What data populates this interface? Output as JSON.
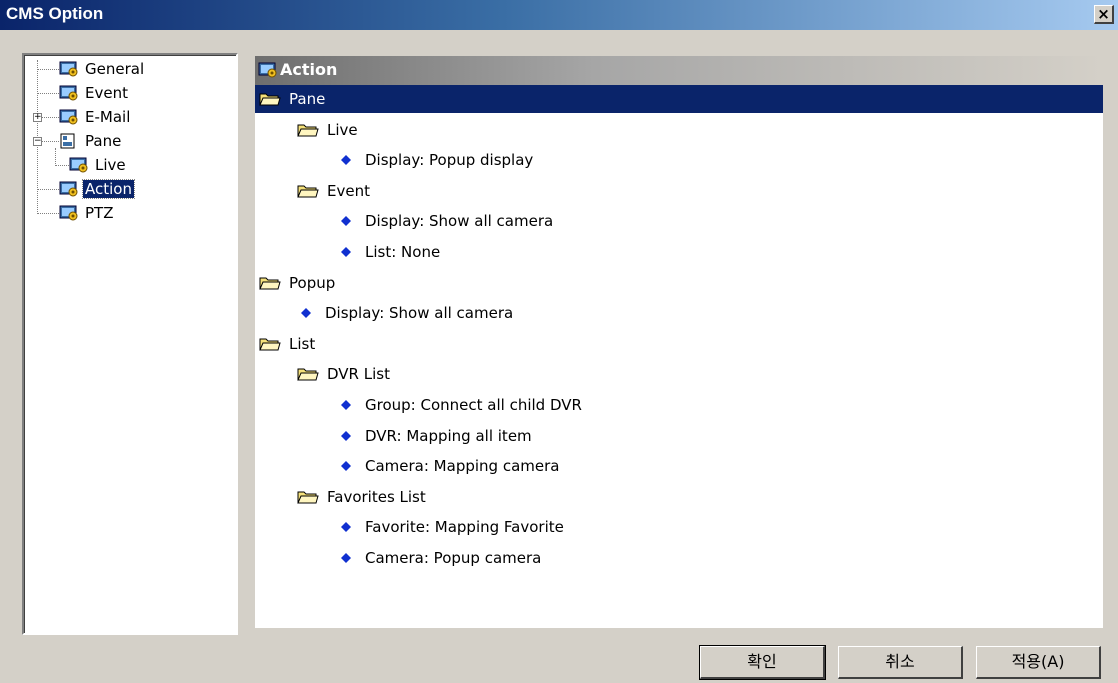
{
  "window": {
    "title": "CMS Option",
    "close_label": "×"
  },
  "tree": [
    {
      "label": "General"
    },
    {
      "label": "Event"
    },
    {
      "label": "E-Mail",
      "expander": "+"
    },
    {
      "label": "Pane",
      "expander": "−"
    },
    {
      "label": "Live"
    },
    {
      "label": "Action",
      "selected": true
    },
    {
      "label": "PTZ"
    }
  ],
  "content": {
    "header": "Action",
    "items": [
      {
        "label": "Pane",
        "kind": "folder",
        "level": 0,
        "selected": true
      },
      {
        "label": "Live",
        "kind": "folder",
        "level": 1
      },
      {
        "label": "Display: Popup display",
        "kind": "option",
        "level": 2
      },
      {
        "label": "Event",
        "kind": "folder",
        "level": 1
      },
      {
        "label": "Display: Show all camera",
        "kind": "option",
        "level": 2
      },
      {
        "label": "List: None",
        "kind": "option",
        "level": 2
      },
      {
        "label": "Popup",
        "kind": "folder",
        "level": 0
      },
      {
        "label": "Display: Show all camera",
        "kind": "option",
        "level": 1
      },
      {
        "label": "List",
        "kind": "folder",
        "level": 0
      },
      {
        "label": "DVR List",
        "kind": "folder",
        "level": 1
      },
      {
        "label": "Group: Connect all child DVR",
        "kind": "option",
        "level": 2
      },
      {
        "label": "DVR: Mapping all item",
        "kind": "option",
        "level": 2
      },
      {
        "label": "Camera: Mapping camera",
        "kind": "option",
        "level": 2
      },
      {
        "label": "Favorites List",
        "kind": "folder",
        "level": 1
      },
      {
        "label": "Favorite: Mapping Favorite",
        "kind": "option",
        "level": 2
      },
      {
        "label": "Camera: Popup camera",
        "kind": "option",
        "level": 2
      }
    ]
  },
  "buttons": {
    "ok": "확인",
    "cancel": "취소",
    "apply": "적용(A)"
  },
  "colors": {
    "selection": "#0a246a",
    "diamond": "#1030d0",
    "folder": "#f5e17a"
  }
}
